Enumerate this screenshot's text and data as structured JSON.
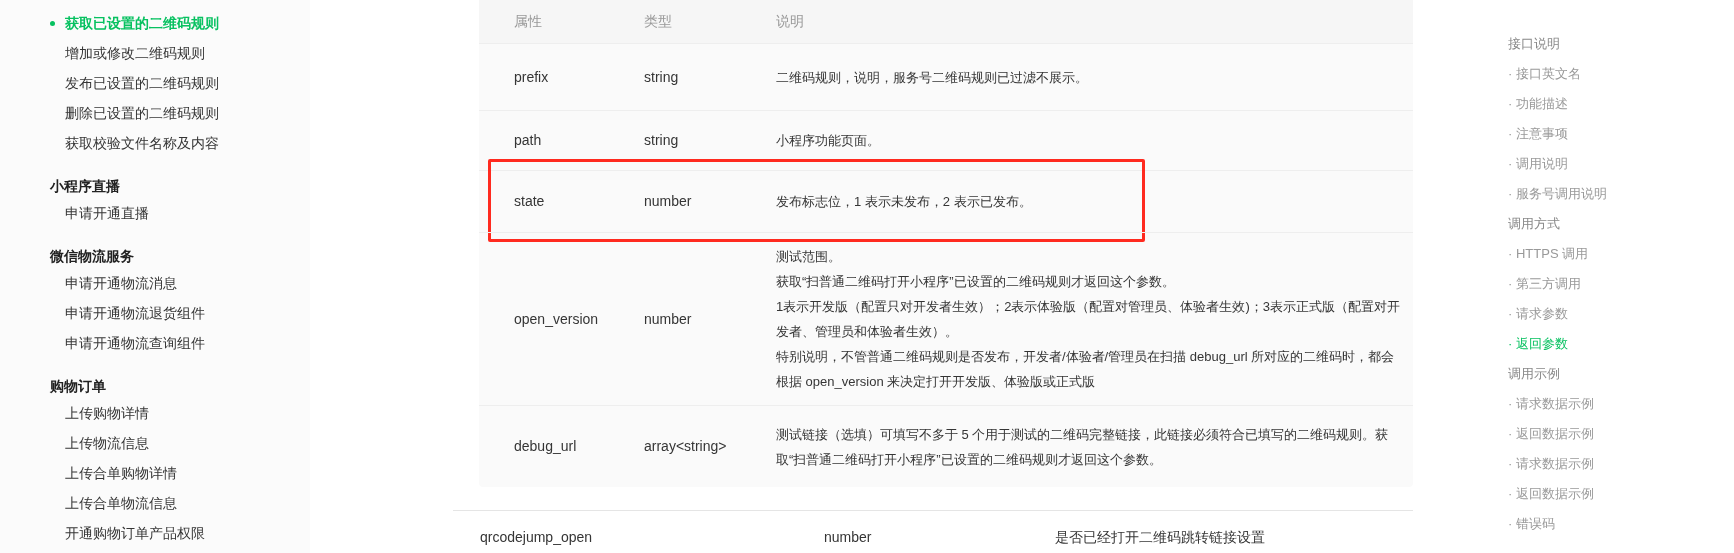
{
  "sidebar": {
    "groups": [
      {
        "items": [
          {
            "label": "获取已设置的二维码规则",
            "selected": true
          },
          {
            "label": "增加或修改二维码规则",
            "selected": false
          },
          {
            "label": "发布已设置的二维码规则",
            "selected": false
          },
          {
            "label": "删除已设置的二维码规则",
            "selected": false
          },
          {
            "label": "获取校验文件名称及内容",
            "selected": false
          }
        ]
      },
      {
        "title": "小程序直播",
        "items": [
          {
            "label": "申请开通直播",
            "selected": false
          }
        ]
      },
      {
        "title": "微信物流服务",
        "items": [
          {
            "label": "申请开通物流消息",
            "selected": false
          },
          {
            "label": "申请开通物流退货组件",
            "selected": false
          },
          {
            "label": "申请开通物流查询组件",
            "selected": false
          }
        ]
      },
      {
        "title": "购物订单",
        "items": [
          {
            "label": "上传购物详情",
            "selected": false
          },
          {
            "label": "上传物流信息",
            "selected": false
          },
          {
            "label": "上传合单购物详情",
            "selected": false
          },
          {
            "label": "上传合单物流信息",
            "selected": false
          },
          {
            "label": "开通购物订单产品权限",
            "selected": false
          }
        ]
      }
    ]
  },
  "table": {
    "columns": [
      "属性",
      "类型",
      "说明"
    ],
    "rows": [
      {
        "name": "prefix",
        "type": "string",
        "description": [
          "二维码规则，说明，服务号二维码规则已过滤不展示。"
        ],
        "highlighted": false
      },
      {
        "name": "path",
        "type": "string",
        "description": [
          "小程序功能页面。"
        ],
        "highlighted": false
      },
      {
        "name": "state",
        "type": "number",
        "description": [
          "发布标志位，1 表示未发布，2 表示已发布。"
        ],
        "highlighted": true
      },
      {
        "name": "open_version",
        "type": "number",
        "description": [
          "测试范围。",
          "获取“扫普通二维码打开小程序”已设置的二维码规则才返回这个参数。",
          "1表示开发版（配置只对开发者生效）；2表示体验版（配置对管理员、体验者生效)；3表示正式版（配置对开发者、管理员和体验者生效）。",
          "特别说明，不管普通二维码规则是否发布，开发者/体验者/管理员在扫描 debug_url 所对应的二维码时，都会根据 open_version 来决定打开开发版、体验版或正式版"
        ],
        "highlighted": false
      },
      {
        "name": "debug_url",
        "type": "array<string>",
        "description": [
          "测试链接（选填）可填写不多于 5 个用于测试的二维码完整链接，此链接必须符合已填写的二维码规则。获取“扫普通二维码打开小程序”已设置的二维码规则才返回这个参数。"
        ],
        "highlighted": false
      }
    ]
  },
  "outer_row": {
    "name": "qrcodejump_open",
    "type": "number",
    "description": "是否已经打开二维码跳转链接设置"
  },
  "toc": [
    {
      "label": "接口说明",
      "kind": "section",
      "selected": false
    },
    {
      "label": "· 接口英文名",
      "kind": "entry",
      "selected": false
    },
    {
      "label": "· 功能描述",
      "kind": "entry",
      "selected": false
    },
    {
      "label": "· 注意事项",
      "kind": "entry",
      "selected": false
    },
    {
      "label": "· 调用说明",
      "kind": "entry",
      "selected": false
    },
    {
      "label": "· 服务号调用说明",
      "kind": "entry",
      "selected": false
    },
    {
      "label": "调用方式",
      "kind": "section",
      "selected": false
    },
    {
      "label": "· HTTPS 调用",
      "kind": "entry",
      "selected": false
    },
    {
      "label": "· 第三方调用",
      "kind": "entry",
      "selected": false
    },
    {
      "label": "· 请求参数",
      "kind": "entry",
      "selected": false
    },
    {
      "label": "· 返回参数",
      "kind": "entry",
      "selected": true
    },
    {
      "label": "调用示例",
      "kind": "section",
      "selected": false
    },
    {
      "label": "· 请求数据示例",
      "kind": "entry",
      "selected": false
    },
    {
      "label": "· 返回数据示例",
      "kind": "entry",
      "selected": false
    },
    {
      "label": "· 请求数据示例",
      "kind": "entry",
      "selected": false
    },
    {
      "label": "· 返回数据示例",
      "kind": "entry",
      "selected": false
    },
    {
      "label": "· 错误码",
      "kind": "entry",
      "selected": false
    }
  ]
}
